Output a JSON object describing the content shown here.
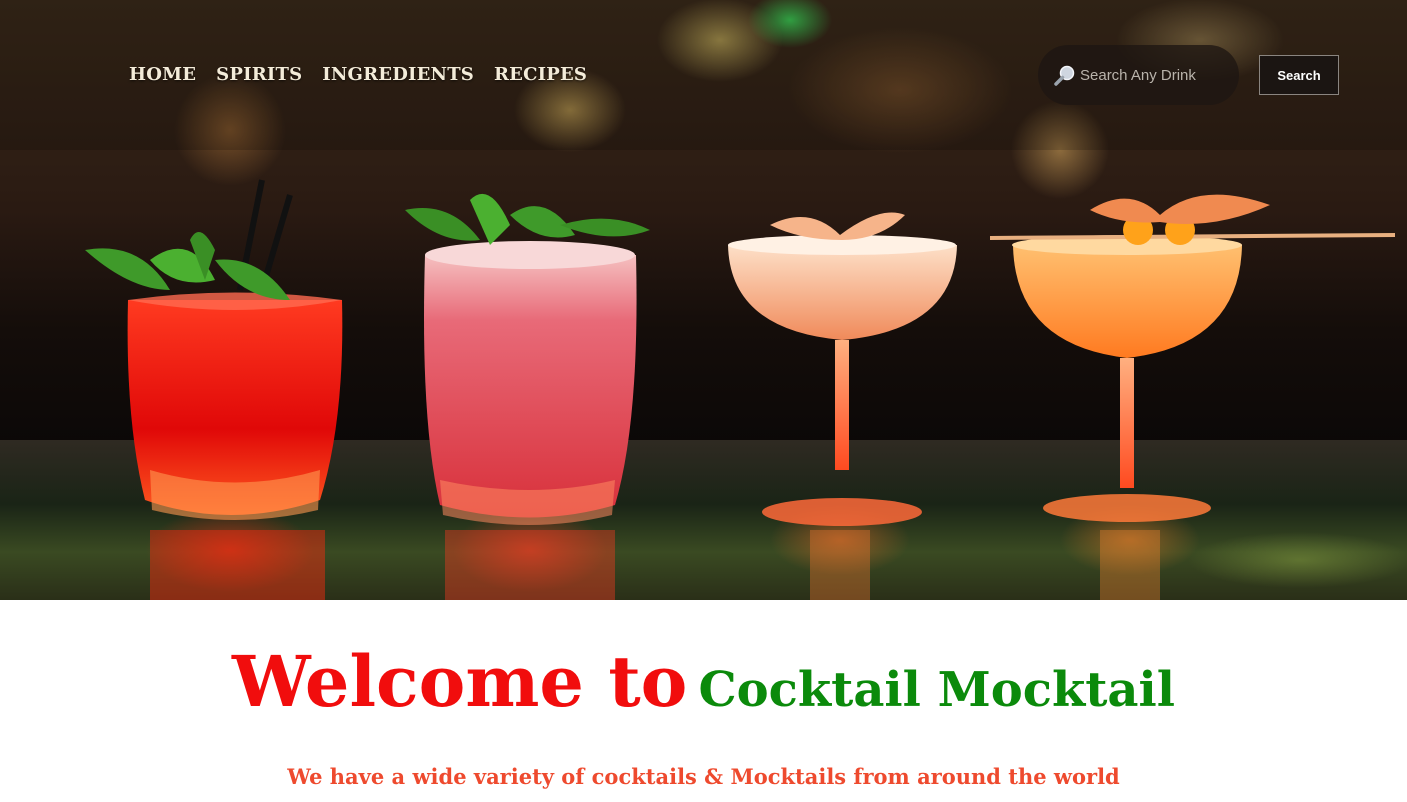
{
  "nav": {
    "items": [
      {
        "label": "HOME"
      },
      {
        "label": "SPIRITS"
      },
      {
        "label": "INGREDIENTS"
      },
      {
        "label": "RECIPES"
      }
    ]
  },
  "search": {
    "placeholder": "Search Any Drink",
    "button_label": "Search",
    "icon": "magnifier-icon"
  },
  "welcome": {
    "prefix": "Welcome to",
    "brand": "Cocktail Mocktail",
    "tagline": "We have a wide variety of cocktails & Mocktails from around the world"
  },
  "colors": {
    "welcome_red": "#f10d0d",
    "brand_green": "#0b8a0b",
    "tagline_orange": "#ee4a2e",
    "nav_text": "#f4ecd9"
  },
  "hero": {
    "image": "hero-image-four-cocktails-on-bar"
  }
}
